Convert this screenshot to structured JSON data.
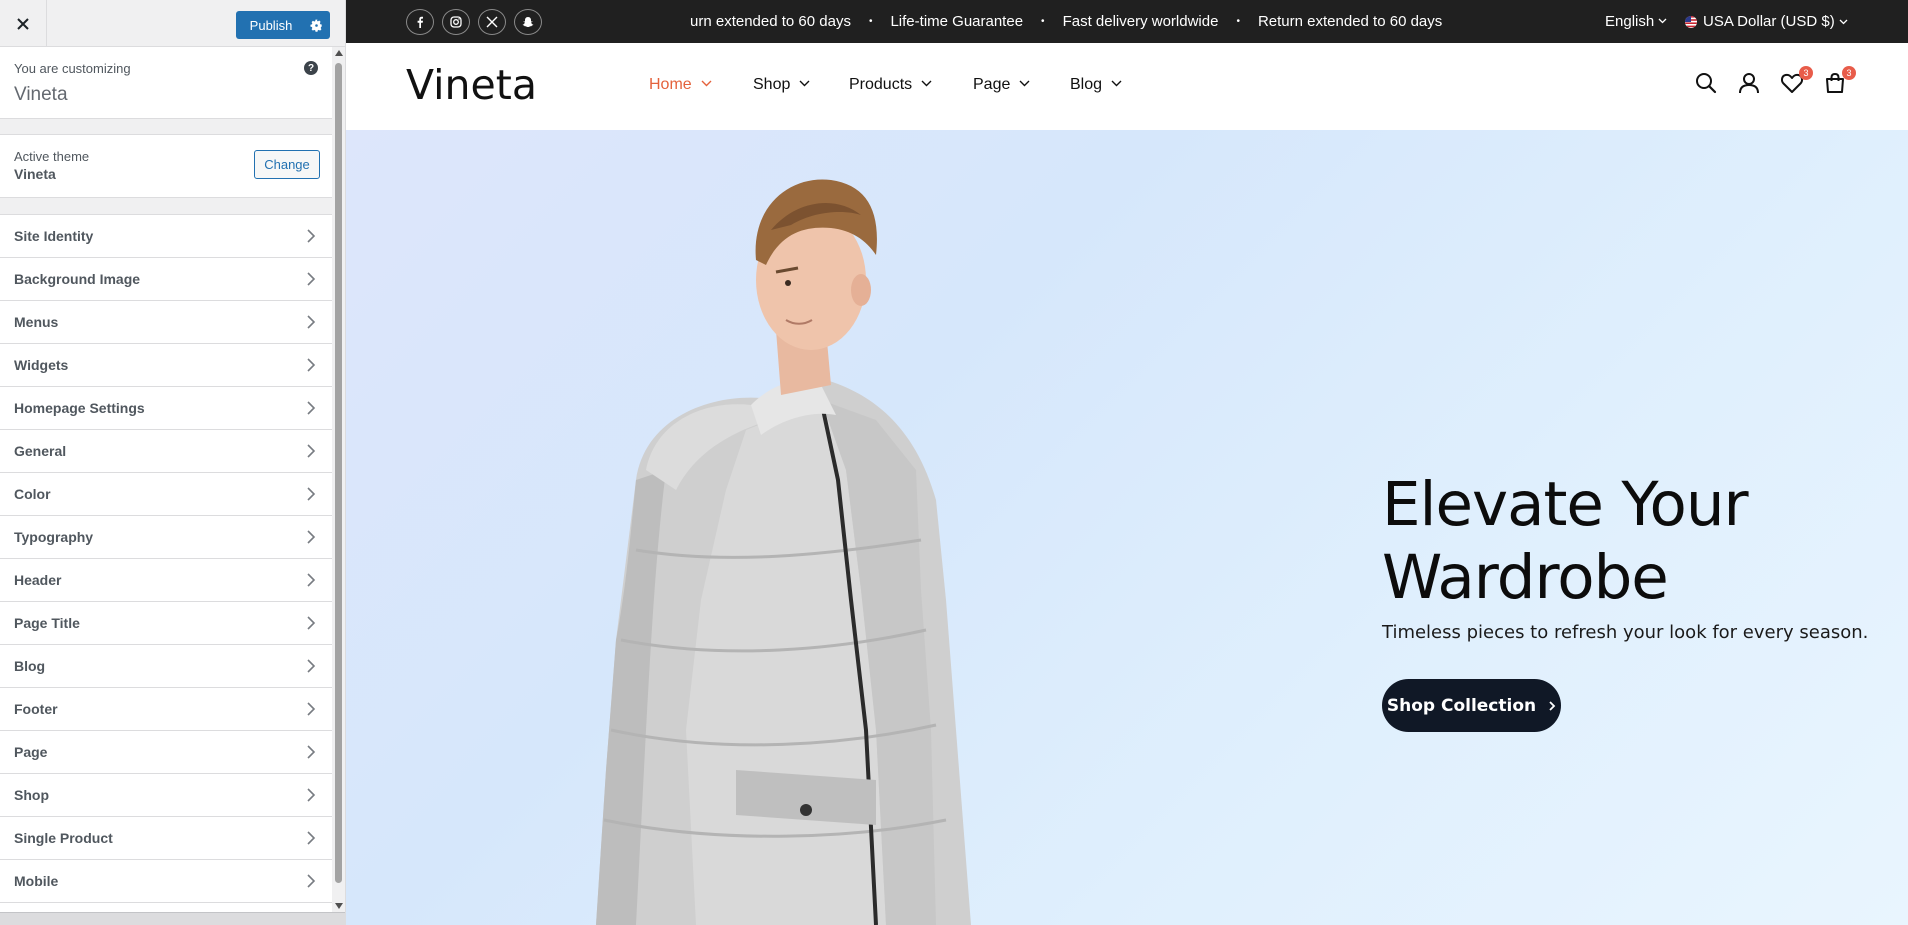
{
  "customizer": {
    "close_label": "×",
    "publish_label": "Publish",
    "info_subtitle": "You are customizing",
    "info_title": "Vineta",
    "help_label": "?",
    "theme_subtitle": "Active theme",
    "theme_name": "Vineta",
    "change_label": "Change",
    "sections": [
      {
        "label": "Site Identity"
      },
      {
        "label": "Background Image"
      },
      {
        "label": "Menus"
      },
      {
        "label": "Widgets"
      },
      {
        "label": "Homepage Settings"
      },
      {
        "label": "General"
      },
      {
        "label": "Color"
      },
      {
        "label": "Typography"
      },
      {
        "label": "Header"
      },
      {
        "label": "Page Title"
      },
      {
        "label": "Blog"
      },
      {
        "label": "Footer"
      },
      {
        "label": "Page"
      },
      {
        "label": "Shop"
      },
      {
        "label": "Single Product"
      },
      {
        "label": "Mobile"
      }
    ]
  },
  "topbar": {
    "social_icons": [
      "facebook-icon",
      "instagram-icon",
      "x-icon",
      "snapchat-icon"
    ],
    "marquee": [
      "urn extended to 60 days",
      "Life-time Guarantee",
      "Fast delivery worldwide",
      "Return extended to 60 days"
    ],
    "dot": "•",
    "language": "English",
    "currency": "USA Dollar (USD $)"
  },
  "header": {
    "logo": "Vineta",
    "nav": [
      "Home",
      "Shop",
      "Products",
      "Page",
      "Blog"
    ],
    "wishlist_count": "3",
    "cart_count": "3"
  },
  "hero": {
    "title_line1": "Elevate Your",
    "title_line2": "Wardrobe",
    "subtitle": "Timeless pieces to refresh your look for every season.",
    "button_label": "Shop Collection"
  },
  "colors": {
    "accent": "#2271b1",
    "nav_active": "#e4623c",
    "topbar_bg": "#202020",
    "button_bg": "#101826",
    "badge": "#e85c4a"
  }
}
